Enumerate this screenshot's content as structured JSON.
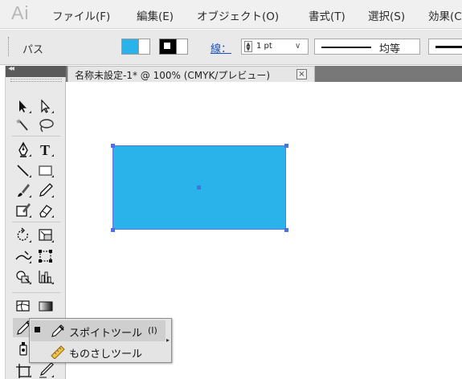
{
  "app": {
    "logo": "Ai"
  },
  "menu": [
    {
      "label": "ファイル(F)",
      "name": "menu-file"
    },
    {
      "label": "編集(E)",
      "name": "menu-edit"
    },
    {
      "label": "オブジェクト(O)",
      "name": "menu-object"
    },
    {
      "label": "書式(T)",
      "name": "menu-type"
    },
    {
      "label": "選択(S)",
      "name": "menu-select"
    },
    {
      "label": "効果(C)",
      "name": "menu-effect"
    }
  ],
  "control_bar": {
    "selection_label": "パス",
    "fill_color": "#2ab3ea",
    "stroke_label": "線：",
    "stroke_weight": "1 pt",
    "stroke_profile_label": "均等"
  },
  "document": {
    "tab_title": "名称未設定-1* @ 100% (CMYK/プレビュー)",
    "close_icon": "close-icon"
  },
  "canvas": {
    "shape": "rectangle",
    "fill_color": "#2ab3ea",
    "stroke_color": "#5b78d6",
    "selection_color": "#4d6fe0"
  },
  "tools": [
    "selection-tool-icon",
    "direct-selection-tool-icon",
    "magic-wand-tool-icon",
    "lasso-tool-icon",
    "pen-tool-icon",
    "type-tool-icon",
    "line-segment-tool-icon",
    "rectangle-tool-icon",
    "paintbrush-tool-icon",
    "pencil-tool-icon",
    "blob-brush-tool-icon",
    "eraser-tool-icon",
    "rotate-tool-icon",
    "scale-tool-icon",
    "width-tool-icon",
    "free-transform-tool-icon",
    "shape-builder-tool-icon",
    "graph-tool-icon",
    "mesh-tool-icon",
    "gradient-tool-icon",
    "eyedropper-tool-icon",
    "symbol-sprayer-tool-icon",
    "artboard-tool-icon",
    "slice-tool-icon"
  ],
  "flyout": {
    "items": [
      {
        "label": "スポイトツール",
        "shortcut": "(I)",
        "selected": true,
        "icon": "eyedropper-icon"
      },
      {
        "label": "ものさしツール",
        "shortcut": "",
        "selected": false,
        "icon": "measure-icon"
      }
    ]
  }
}
